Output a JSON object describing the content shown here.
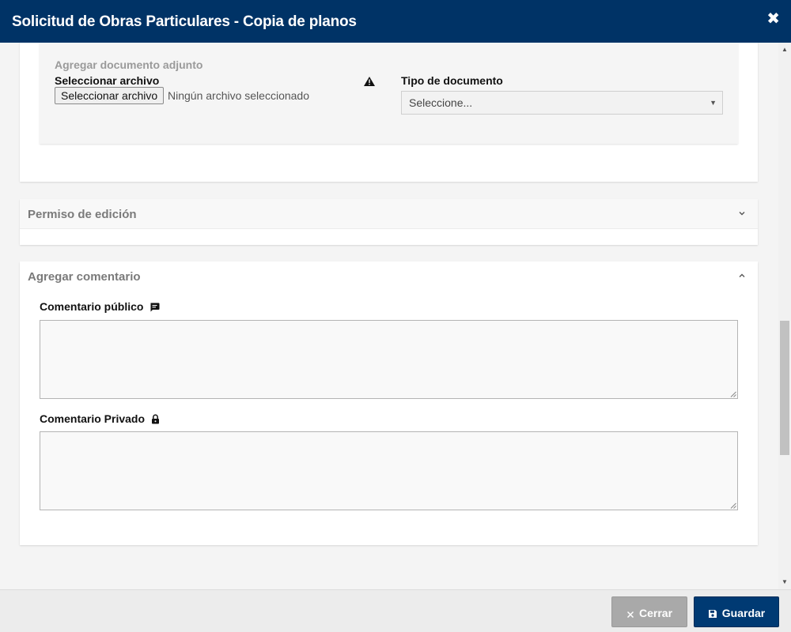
{
  "window": {
    "title": "Solicitud de Obras Particulares - Copia de planos",
    "close_glyph": "✖"
  },
  "attachment": {
    "heading": "Agregar documento adjunto",
    "file_label": "Seleccionar archivo",
    "file_button": "Seleccionar archivo",
    "file_status": "Ningún archivo seleccionado",
    "warning_icon": "warning-triangle-icon",
    "type_label": "Tipo de documento",
    "type_selected": "Seleccione..."
  },
  "permiso": {
    "title": "Permiso de edición",
    "chevron_icon": "chevron-down-icon"
  },
  "comentario": {
    "title": "Agregar comentario",
    "chevron_icon": "chevron-up-icon",
    "public_label": "Comentario público",
    "public_icon": "comment-icon",
    "public_value": "",
    "private_label": "Comentario Privado",
    "private_icon": "lock-icon",
    "private_value": ""
  },
  "footer": {
    "close_label": "Cerrar",
    "save_label": "Guardar"
  },
  "colors": {
    "header": "#003366",
    "save_button": "#003a73",
    "close_button": "#a9a9a9"
  }
}
